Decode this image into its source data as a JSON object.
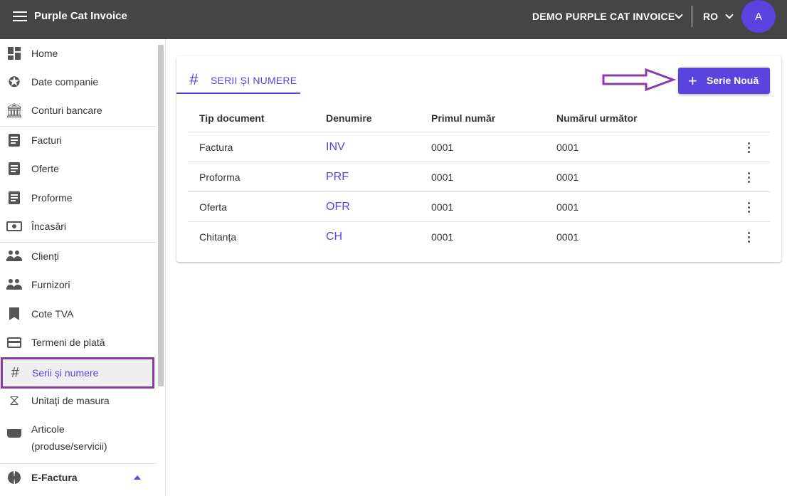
{
  "app": {
    "title": "Purple Cat Invoice"
  },
  "header": {
    "company": "DEMO PURPLE CAT INVOICE",
    "language": "RO",
    "avatar_initial": "A"
  },
  "sidebar": {
    "items": [
      {
        "label": "Home",
        "icon": "dashboard-icon"
      },
      {
        "label": "Date companie",
        "icon": "badge-icon"
      },
      {
        "label": "Conturi bancare",
        "icon": "bank-icon"
      },
      {
        "label": "Facturi",
        "icon": "document-icon"
      },
      {
        "label": "Oferte",
        "icon": "document-icon"
      },
      {
        "label": "Proforme",
        "icon": "document-icon"
      },
      {
        "label": "Încasări",
        "icon": "cash-icon"
      },
      {
        "label": "Clienți",
        "icon": "people-icon"
      },
      {
        "label": "Furnizori",
        "icon": "people-icon"
      },
      {
        "label": "Cote TVA",
        "icon": "bookmark-icon"
      },
      {
        "label": "Termeni de plată",
        "icon": "credit-card-icon"
      },
      {
        "label": "Serii și numere",
        "icon": "hash-icon"
      },
      {
        "label": "Unitați de masura",
        "icon": "scale-icon"
      },
      {
        "label": "Articole",
        "label2": "(produse/servicii)",
        "icon": "basket-icon"
      },
      {
        "label": "E-Factura",
        "icon": "pie-icon"
      }
    ],
    "active": "Serii și numere"
  },
  "main": {
    "tab_label": "SERII ȘI NUMERE",
    "new_button_label": "Serie Nouă",
    "columns": [
      "Tip document",
      "Denumire",
      "Primul număr",
      "Numărul următor"
    ],
    "rows": [
      {
        "type": "Factura",
        "code": "INV",
        "first": "0001",
        "next": "0001"
      },
      {
        "type": "Proforma",
        "code": "PRF",
        "first": "0001",
        "next": "0001"
      },
      {
        "type": "Oferta",
        "code": "OFR",
        "first": "0001",
        "next": "0001"
      },
      {
        "type": "Chitanța",
        "code": "CH",
        "first": "0001",
        "next": "0001"
      }
    ]
  },
  "colors": {
    "accent": "#5b43e0",
    "topbar": "#454545",
    "highlight": "#8b3aa8"
  }
}
